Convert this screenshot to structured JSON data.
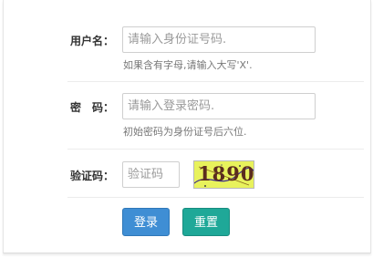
{
  "form": {
    "username": {
      "label": "用户名：",
      "placeholder": "请输入身份证号码.",
      "hint": "如果含有字母,请输入大写'X'."
    },
    "password": {
      "label": "密　码：",
      "placeholder": "请输入登录密码.",
      "hint": "初始密码为身份证号后六位."
    },
    "captcha": {
      "label": "验证码：",
      "placeholder": "验证码",
      "image_text": "1890"
    },
    "buttons": {
      "login": "登录",
      "reset": "重置"
    }
  },
  "colors": {
    "login_button": "#3f8ed4",
    "reset_button": "#1fa898",
    "captcha_background": "#e8f25c"
  }
}
